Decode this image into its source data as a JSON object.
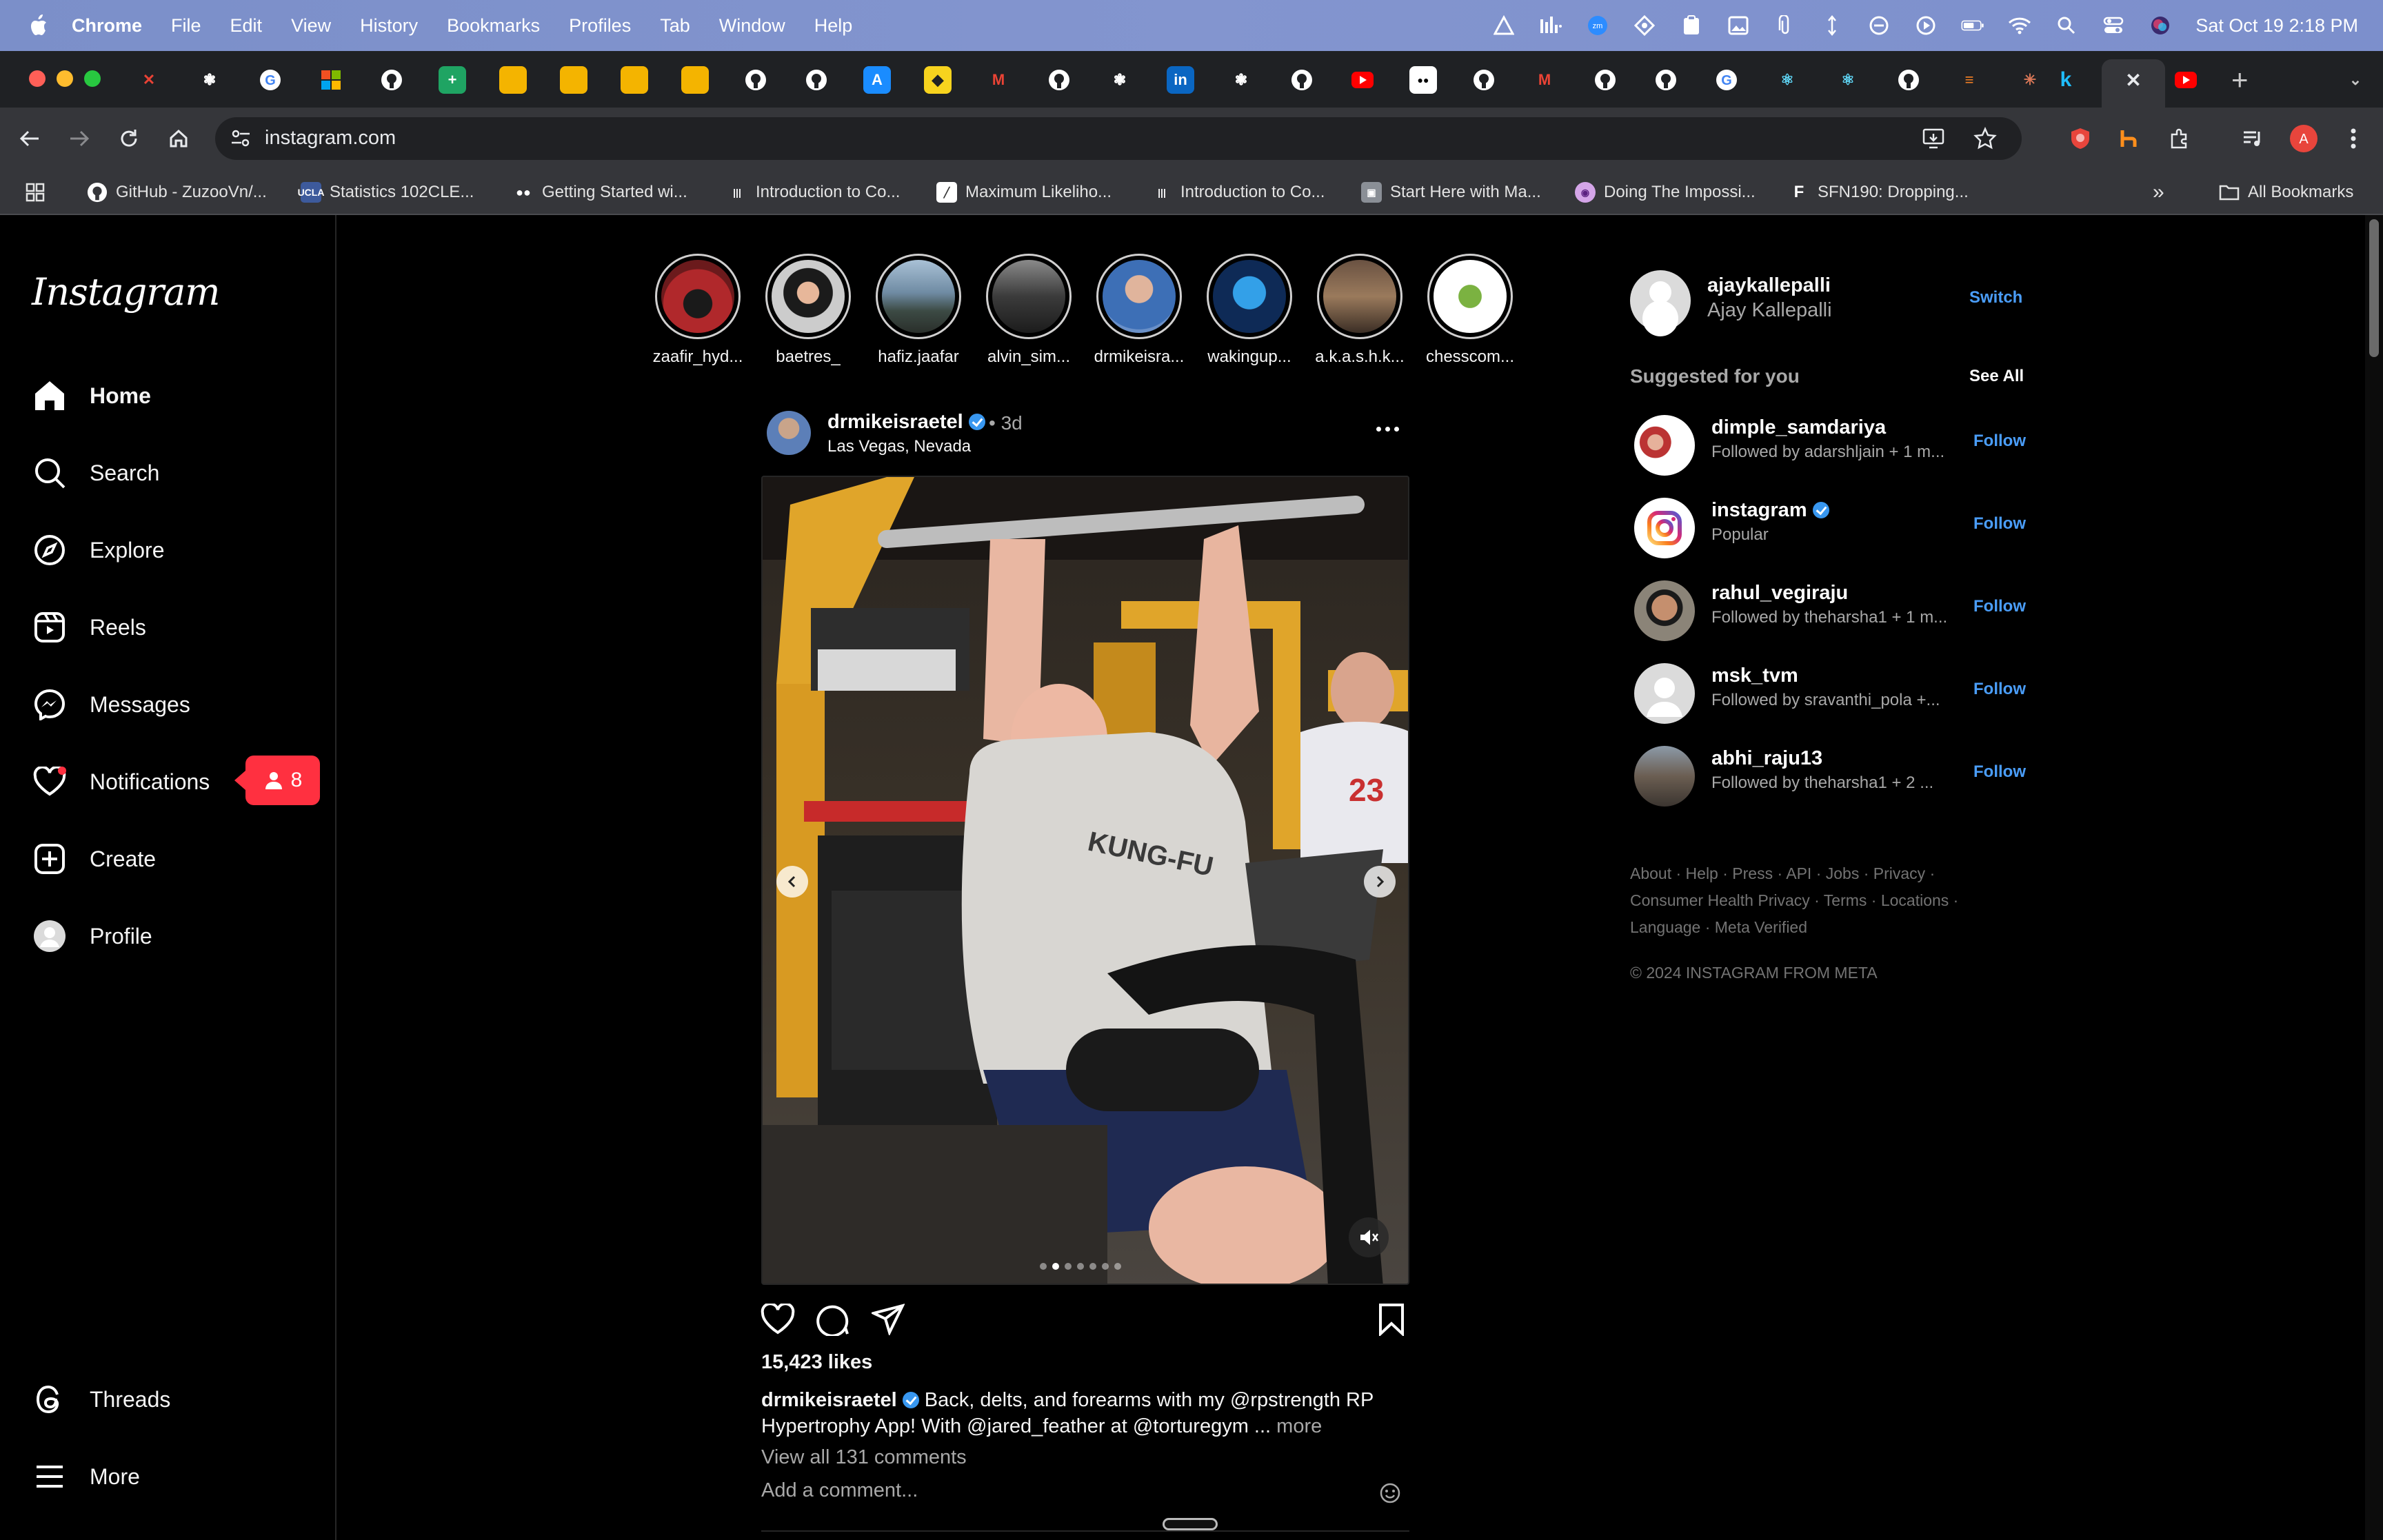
{
  "menubar": {
    "app": "Chrome",
    "items": [
      "File",
      "Edit",
      "View",
      "History",
      "Bookmarks",
      "Profiles",
      "Tab",
      "Window",
      "Help"
    ],
    "datetime": "Sat Oct 19  2:18 PM"
  },
  "browser": {
    "url": "instagram.com",
    "profile_initial": "A",
    "bookmarks": [
      "GitHub - ZuzooVn/...",
      "Statistics 102CLE...",
      "Getting Started wi...",
      "Introduction to Co...",
      "Maximum Likeliho...",
      "Introduction to Co...",
      "Start Here with Ma...",
      "Doing The Impossi...",
      "SFN190: Dropping..."
    ],
    "all_bookmarks": "All Bookmarks",
    "overflow": "»"
  },
  "sidebar": {
    "logo": "Instagram",
    "nav": {
      "home": "Home",
      "search": "Search",
      "explore": "Explore",
      "reels": "Reels",
      "messages": "Messages",
      "notifications": "Notifications",
      "create": "Create",
      "profile": "Profile",
      "threads": "Threads",
      "more": "More"
    },
    "notification_count": "8"
  },
  "stories": [
    {
      "name": "zaafir_hyd..."
    },
    {
      "name": "baetres_"
    },
    {
      "name": "hafiz.jaafar"
    },
    {
      "name": "alvin_sim..."
    },
    {
      "name": "drmikeisra..."
    },
    {
      "name": "wakingup..."
    },
    {
      "name": "a.k.a.s.h.k..."
    },
    {
      "name": "chesscom..."
    }
  ],
  "post": {
    "username": "drmikeisraetel",
    "time": "3d",
    "separator": "•",
    "location": "Las Vegas, Nevada",
    "likes": "15,423 likes",
    "caption_user": "drmikeisraetel",
    "caption_text": "Back, delts, and forearms with my @rpstrength RP Hypertrophy App! With @jared_feather at @torturegym ...",
    "caption_more": "more",
    "view_comments": "View all 131 comments",
    "add_comment_placeholder": "Add a comment...",
    "carousel_count": 7,
    "carousel_active": 2,
    "shirt_text": "EVERYBODY WAS KUNG-FU FIGHTING",
    "jersey_number": "23"
  },
  "me": {
    "username": "ajaykallepalli",
    "full_name": "Ajay Kallepalli",
    "switch": "Switch"
  },
  "suggested": {
    "title": "Suggested for you",
    "see_all": "See All",
    "follow_label": "Follow",
    "items": [
      {
        "username": "dimple_samdariya",
        "sub": "Followed by adarshljain + 1 m...",
        "verified": false
      },
      {
        "username": "instagram",
        "sub": "Popular",
        "verified": true
      },
      {
        "username": "rahul_vegiraju",
        "sub": "Followed by theharsha1 + 1 m...",
        "verified": false
      },
      {
        "username": "msk_tvm",
        "sub": "Followed by sravanthi_pola +...",
        "verified": false
      },
      {
        "username": "abhi_raju13",
        "sub": "Followed by theharsha1 + 2 ...",
        "verified": false
      }
    ]
  },
  "footer": {
    "links_line1": "About · Help · Press · API · Jobs · Privacy ·",
    "links_line2": "Consumer Health Privacy · Terms · Locations ·",
    "links_line3": "Language · Meta Verified",
    "copyright": "© 2024 INSTAGRAM FROM META"
  },
  "colors": {
    "accent_blue": "#4a9df8",
    "notification_red": "#ff3040",
    "verified_blue": "#3897f0",
    "menubar": "#8193cd"
  }
}
